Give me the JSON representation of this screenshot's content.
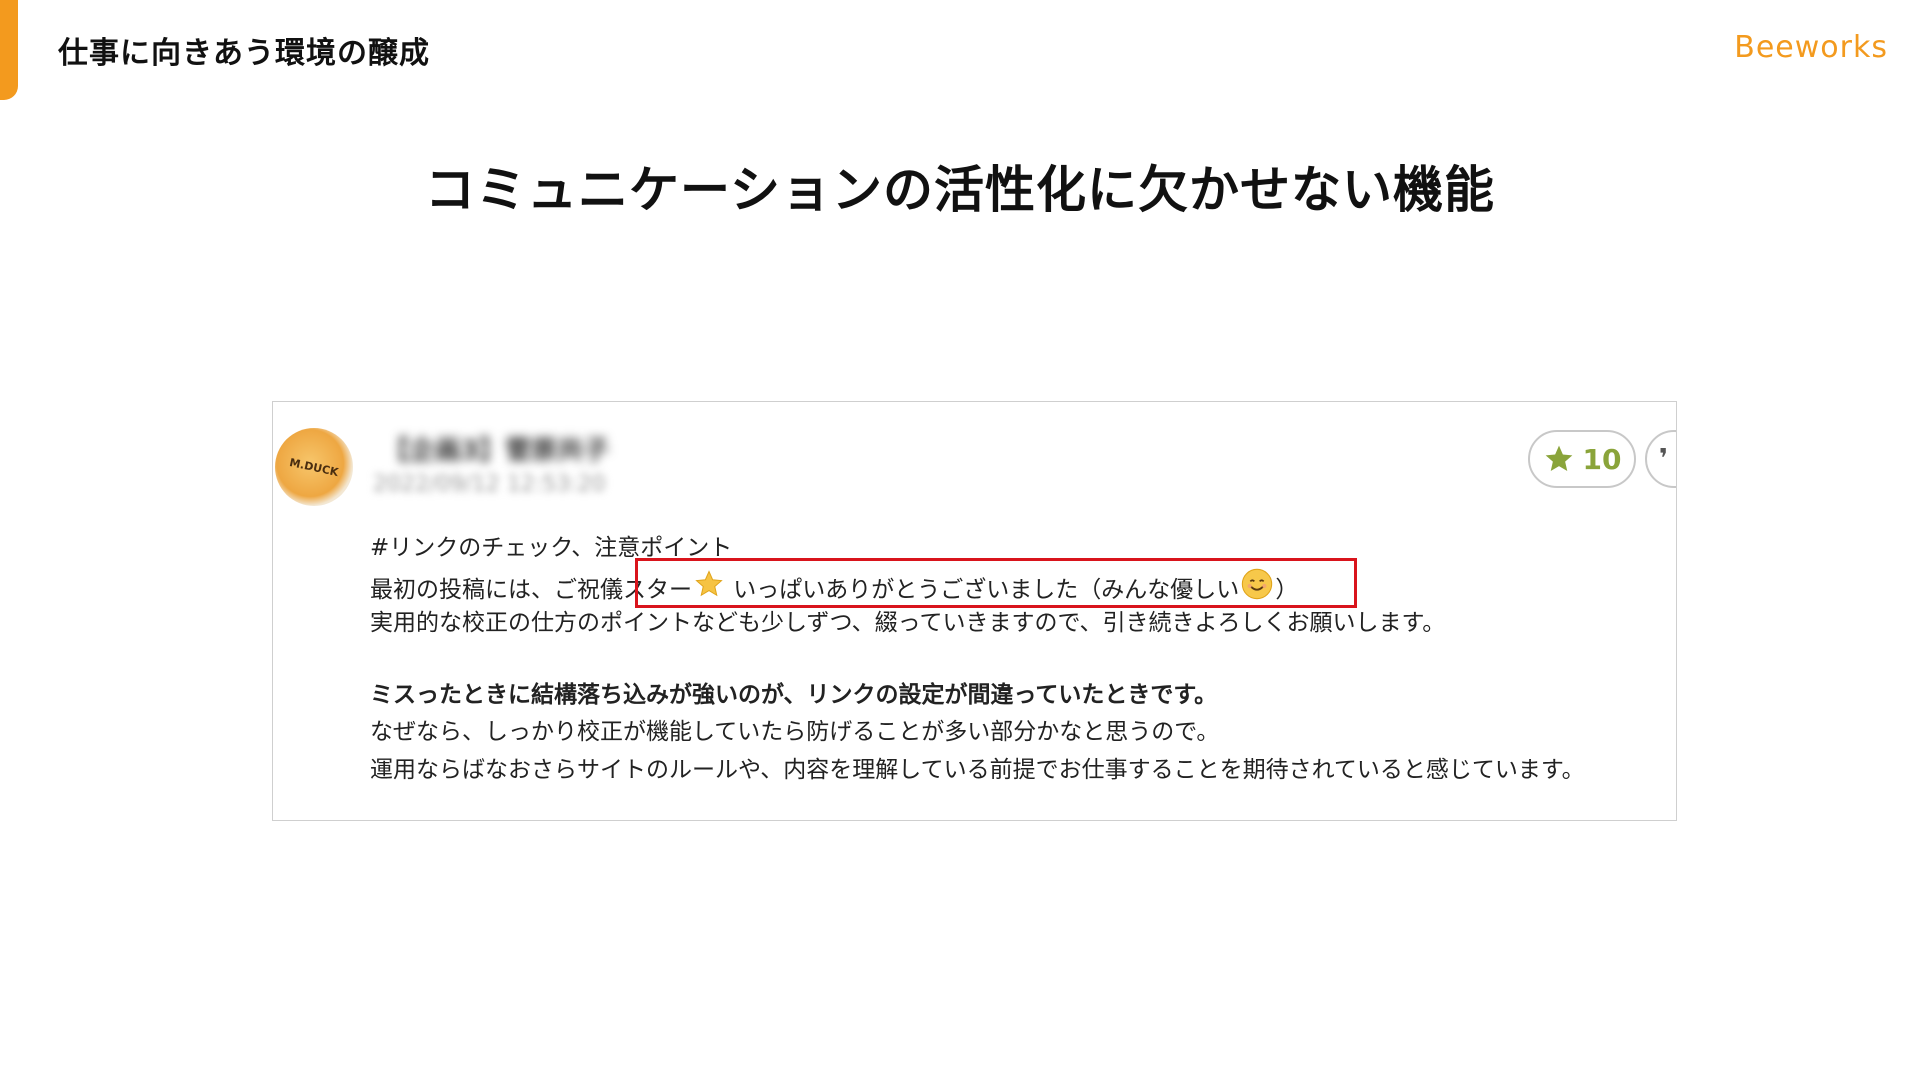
{
  "header": {
    "section_title": "仕事に向きあう環境の醸成",
    "brand": "Beeworks"
  },
  "slide": {
    "heading": "コミュニケーションの活性化に欠かせない機能"
  },
  "post": {
    "author": "【企画3】菅原共子",
    "date": "2022/09/12 12:53:20",
    "avatar_text": "M.DUCK",
    "star_count": "10",
    "star_icon": "star-icon",
    "reply_icon": "reply-icon",
    "lines": {
      "l1": "#リンクのチェック、注意ポイント",
      "l2a": "最初の投稿には、ご祝儀スター",
      "l2b": " いっぱいありがとうございました（みんな優しい",
      "l2c": "）",
      "l3": "実用的な校正の仕方のポイントなども少しずつ、綴っていきますので、引き続きよろしくお願いします。",
      "l4": "ミスったときに結構落ち込みが強いのが、リンクの設定が間違っていたときです。",
      "l5": "なぜなら、しっかり校正が機能していたら防げることが多い部分かなと思うので。",
      "l6": "運用ならばなおさらサイトのルールや、内容を理解している前提でお仕事することを期待されていると感じています。"
    }
  },
  "colors": {
    "accent": "#f39a1e",
    "highlight": "#d9141c",
    "star_count": "#8aa43a"
  }
}
